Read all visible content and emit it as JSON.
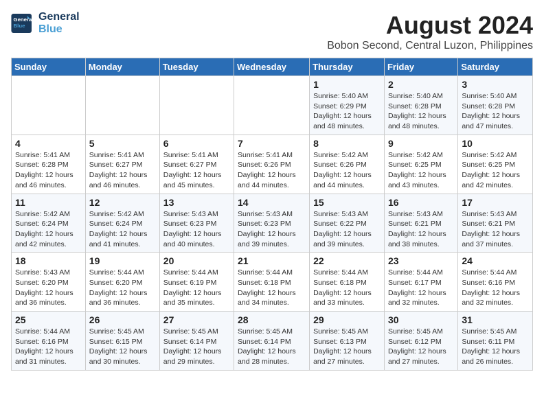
{
  "logo": {
    "line1": "General",
    "line2": "Blue"
  },
  "title": "August 2024",
  "location": "Bobon Second, Central Luzon, Philippines",
  "days_of_week": [
    "Sunday",
    "Monday",
    "Tuesday",
    "Wednesday",
    "Thursday",
    "Friday",
    "Saturday"
  ],
  "weeks": [
    [
      {
        "day": "",
        "info": ""
      },
      {
        "day": "",
        "info": ""
      },
      {
        "day": "",
        "info": ""
      },
      {
        "day": "",
        "info": ""
      },
      {
        "day": "1",
        "info": "Sunrise: 5:40 AM\nSunset: 6:29 PM\nDaylight: 12 hours\nand 48 minutes."
      },
      {
        "day": "2",
        "info": "Sunrise: 5:40 AM\nSunset: 6:28 PM\nDaylight: 12 hours\nand 48 minutes."
      },
      {
        "day": "3",
        "info": "Sunrise: 5:40 AM\nSunset: 6:28 PM\nDaylight: 12 hours\nand 47 minutes."
      }
    ],
    [
      {
        "day": "4",
        "info": "Sunrise: 5:41 AM\nSunset: 6:28 PM\nDaylight: 12 hours\nand 46 minutes."
      },
      {
        "day": "5",
        "info": "Sunrise: 5:41 AM\nSunset: 6:27 PM\nDaylight: 12 hours\nand 46 minutes."
      },
      {
        "day": "6",
        "info": "Sunrise: 5:41 AM\nSunset: 6:27 PM\nDaylight: 12 hours\nand 45 minutes."
      },
      {
        "day": "7",
        "info": "Sunrise: 5:41 AM\nSunset: 6:26 PM\nDaylight: 12 hours\nand 44 minutes."
      },
      {
        "day": "8",
        "info": "Sunrise: 5:42 AM\nSunset: 6:26 PM\nDaylight: 12 hours\nand 44 minutes."
      },
      {
        "day": "9",
        "info": "Sunrise: 5:42 AM\nSunset: 6:25 PM\nDaylight: 12 hours\nand 43 minutes."
      },
      {
        "day": "10",
        "info": "Sunrise: 5:42 AM\nSunset: 6:25 PM\nDaylight: 12 hours\nand 42 minutes."
      }
    ],
    [
      {
        "day": "11",
        "info": "Sunrise: 5:42 AM\nSunset: 6:24 PM\nDaylight: 12 hours\nand 42 minutes."
      },
      {
        "day": "12",
        "info": "Sunrise: 5:42 AM\nSunset: 6:24 PM\nDaylight: 12 hours\nand 41 minutes."
      },
      {
        "day": "13",
        "info": "Sunrise: 5:43 AM\nSunset: 6:23 PM\nDaylight: 12 hours\nand 40 minutes."
      },
      {
        "day": "14",
        "info": "Sunrise: 5:43 AM\nSunset: 6:23 PM\nDaylight: 12 hours\nand 39 minutes."
      },
      {
        "day": "15",
        "info": "Sunrise: 5:43 AM\nSunset: 6:22 PM\nDaylight: 12 hours\nand 39 minutes."
      },
      {
        "day": "16",
        "info": "Sunrise: 5:43 AM\nSunset: 6:21 PM\nDaylight: 12 hours\nand 38 minutes."
      },
      {
        "day": "17",
        "info": "Sunrise: 5:43 AM\nSunset: 6:21 PM\nDaylight: 12 hours\nand 37 minutes."
      }
    ],
    [
      {
        "day": "18",
        "info": "Sunrise: 5:43 AM\nSunset: 6:20 PM\nDaylight: 12 hours\nand 36 minutes."
      },
      {
        "day": "19",
        "info": "Sunrise: 5:44 AM\nSunset: 6:20 PM\nDaylight: 12 hours\nand 36 minutes."
      },
      {
        "day": "20",
        "info": "Sunrise: 5:44 AM\nSunset: 6:19 PM\nDaylight: 12 hours\nand 35 minutes."
      },
      {
        "day": "21",
        "info": "Sunrise: 5:44 AM\nSunset: 6:18 PM\nDaylight: 12 hours\nand 34 minutes."
      },
      {
        "day": "22",
        "info": "Sunrise: 5:44 AM\nSunset: 6:18 PM\nDaylight: 12 hours\nand 33 minutes."
      },
      {
        "day": "23",
        "info": "Sunrise: 5:44 AM\nSunset: 6:17 PM\nDaylight: 12 hours\nand 32 minutes."
      },
      {
        "day": "24",
        "info": "Sunrise: 5:44 AM\nSunset: 6:16 PM\nDaylight: 12 hours\nand 32 minutes."
      }
    ],
    [
      {
        "day": "25",
        "info": "Sunrise: 5:44 AM\nSunset: 6:16 PM\nDaylight: 12 hours\nand 31 minutes."
      },
      {
        "day": "26",
        "info": "Sunrise: 5:45 AM\nSunset: 6:15 PM\nDaylight: 12 hours\nand 30 minutes."
      },
      {
        "day": "27",
        "info": "Sunrise: 5:45 AM\nSunset: 6:14 PM\nDaylight: 12 hours\nand 29 minutes."
      },
      {
        "day": "28",
        "info": "Sunrise: 5:45 AM\nSunset: 6:14 PM\nDaylight: 12 hours\nand 28 minutes."
      },
      {
        "day": "29",
        "info": "Sunrise: 5:45 AM\nSunset: 6:13 PM\nDaylight: 12 hours\nand 27 minutes."
      },
      {
        "day": "30",
        "info": "Sunrise: 5:45 AM\nSunset: 6:12 PM\nDaylight: 12 hours\nand 27 minutes."
      },
      {
        "day": "31",
        "info": "Sunrise: 5:45 AM\nSunset: 6:11 PM\nDaylight: 12 hours\nand 26 minutes."
      }
    ]
  ]
}
